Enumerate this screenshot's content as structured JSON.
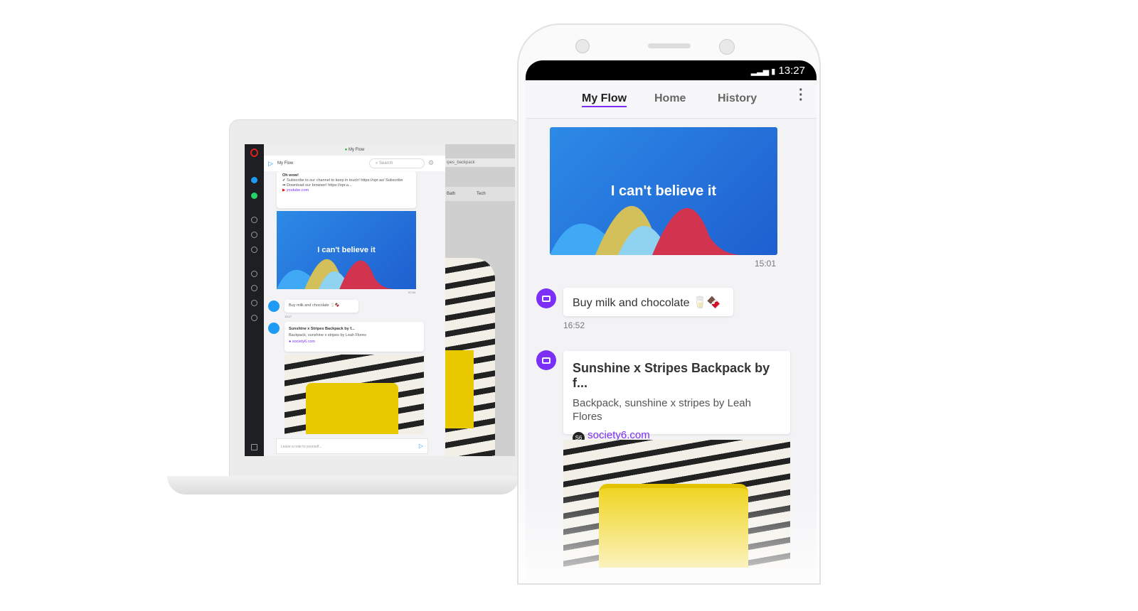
{
  "laptop": {
    "browser_title": "My Flow",
    "panel_title": "My Flow",
    "search_placeholder": "Search",
    "bg_url_fragment": "ipes_backpack",
    "bg_categories": [
      "Bath",
      "Tech"
    ],
    "messages": [
      {
        "title": "Oh wow!",
        "lines": [
          "✔ Subscribe to our channel to keep in touch! https://opr.as/ Subscribe",
          "➡ Download our browser! https://opr.a..."
        ],
        "source": "youtube.com"
      },
      {
        "video_text": "I can't believe it",
        "time": "07:44"
      },
      {
        "text": "Buy milk and chocolate 🥛🍫",
        "time": "13:17"
      },
      {
        "title": "Sunshine x Stripes Backpack by f...",
        "desc": "Backpack, sunshine x stripes by Leah Flores",
        "source": "society6.com"
      }
    ],
    "note_placeholder": "Leave a note to yourself..."
  },
  "phone": {
    "status_time": "13:27",
    "tabs": [
      {
        "label": "My Flow",
        "active": true
      },
      {
        "label": "Home"
      },
      {
        "label": "History"
      }
    ],
    "video": {
      "text": "I can't believe it",
      "time": "15:01"
    },
    "note": {
      "text": "Buy milk and chocolate 🥛🍫",
      "time": "16:52"
    },
    "link": {
      "title": "Sunshine x Stripes Backpack by f...",
      "desc": "Backpack, sunshine x stripes by Leah Flores",
      "source": "society6.com",
      "source_icon": "S6"
    }
  },
  "colors": {
    "accent": "#7b2ff7",
    "laptop_accent": "#1e9bf5",
    "link": "#7b2ff7"
  }
}
